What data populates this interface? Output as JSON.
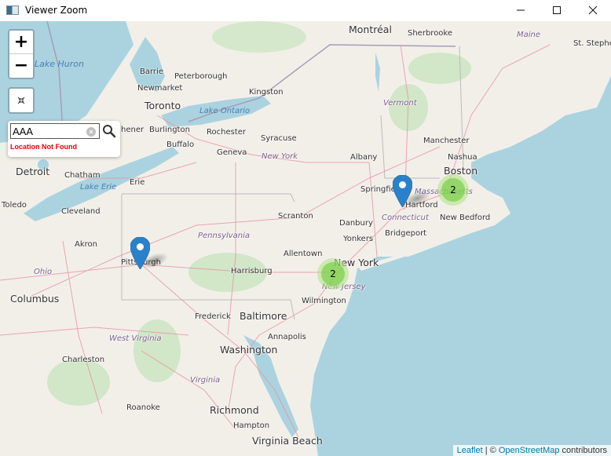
{
  "window": {
    "title": "Viewer Zoom",
    "minimize_label": "—",
    "maximize_label": "☐",
    "close_label": "✕"
  },
  "controls": {
    "zoom_in_label": "+",
    "zoom_out_label": "−",
    "fit_label": "⌘"
  },
  "search": {
    "value": "AAA",
    "clear_label": "×",
    "error": "Location Not Found"
  },
  "markers": [
    {
      "name": "Pittsburgh",
      "type": "pin"
    },
    {
      "name": "Hartford",
      "type": "pin"
    }
  ],
  "clusters": [
    {
      "location": "New Jersey",
      "count": "2"
    },
    {
      "location": "Boston",
      "count": "2"
    }
  ],
  "colors": {
    "marker": "#2a81cb",
    "cluster_outer": "#b5e28c",
    "cluster_inner": "#6ecc39",
    "water": "#aad3df",
    "land": "#f2efe9",
    "error": "#ee0000"
  },
  "labels": {
    "montreal": "Montréal",
    "sherbrooke": "Sherbrooke",
    "maine": "Maine",
    "ststephen": "St. Stephe",
    "lake_huron": "Lake Huron",
    "barrie": "Barrie",
    "peterborough": "Peterborough",
    "newmarket": "Newmarket",
    "kingston": "Kingston",
    "toronto": "Toronto",
    "lake_ontario": "Lake Ontario",
    "vermont": "Vermont",
    "kitchener": "hener",
    "burlington": "Burlington",
    "rochester": "Rochester",
    "syracuse": "Syracuse",
    "manchester": "Manchester",
    "buffalo": "Buffalo",
    "geneva": "Geneva",
    "new_york_state": "New York",
    "albany": "Albany",
    "nashua": "Nashua",
    "boston": "Boston",
    "detroit": "Detroit",
    "chatham": "Chatham",
    "erie": "Erie",
    "lake_erie": "Lake Erie",
    "springfield": "Springfie",
    "massachusetts": "Massachusetts",
    "hartford": "Hartford",
    "toledo": "Toledo",
    "cleveland": "Cleveland",
    "scranton": "Scranton",
    "connecticut": "Connecticut",
    "new_bedford": "New Bedford",
    "danbury": "Danbury",
    "bridgeport": "Bridgeport",
    "pennsylvania": "Pennsylvania",
    "akron": "Akron",
    "yonkers": "Yonkers",
    "allentown": "Allentown",
    "pittsburgh": "Pittsburgh",
    "new_york_city": "New York",
    "ohio": "Ohio",
    "harrisburg": "Harrisburg",
    "new_jersey": "New Jersey",
    "columbus": "Columbus",
    "wilmington": "Wilmington",
    "frederick": "Frederick",
    "baltimore": "Baltimore",
    "west_virginia": "West Virginia",
    "annapolis": "Annapolis",
    "washington": "Washington",
    "charleston": "Charleston",
    "virginia": "Virginia",
    "roanoke": "Roanoke",
    "richmond": "Richmond",
    "hampton": "Hampton",
    "virginia_beach": "Virginia Beach"
  },
  "attribution": {
    "leaflet": "Leaflet",
    "separator": " | © ",
    "osm": "OpenStreetMap",
    "suffix": " contributors"
  }
}
